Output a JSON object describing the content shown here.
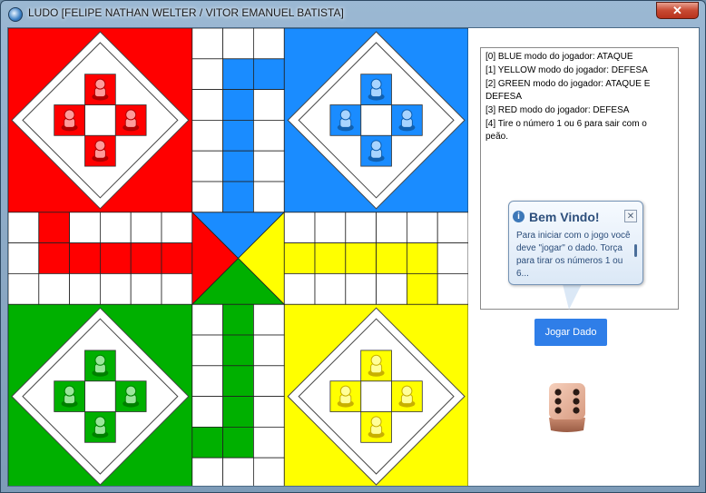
{
  "window": {
    "title": "LUDO [FELIPE NATHAN WELTER / VITOR EMANUEL BATISTA]",
    "close_label": "✕"
  },
  "colors": {
    "red": "#ff0000",
    "blue": "#1a8cff",
    "green": "#00b000",
    "yellow": "#ffff00",
    "button_blue": "#2f7ee8"
  },
  "messages": [
    "[0] BLUE modo do jogador: ATAQUE",
    "[1] YELLOW modo do jogador: DEFESA",
    "[2] GREEN modo do jogador: ATAQUE E",
    "DEFESA",
    "[3] RED modo do jogador: DEFESA",
    "[4] Tire o número 1 ou 6 para sair com o",
    "peão."
  ],
  "tooltip": {
    "title": "Bem Vindo!",
    "body": "Para iniciar com o jogo você deve \"jogar\" o dado. Torça para tirar os números 1 ou 6...",
    "icon": "info-icon"
  },
  "roll_button": {
    "label": "Jogar Dado"
  },
  "dice": {
    "value": 6
  },
  "board": {
    "pieces_per_player": 4
  }
}
